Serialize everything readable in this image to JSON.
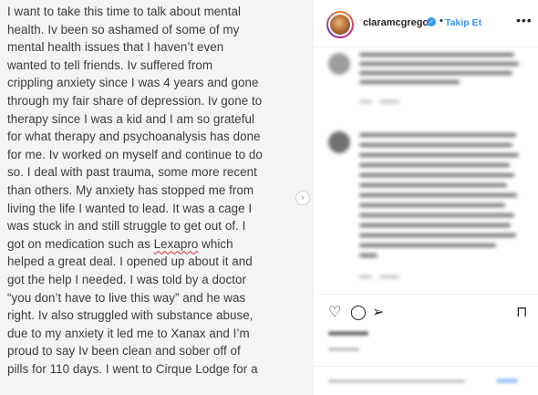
{
  "post": {
    "lines": [
      "I  want to take this time to talk about mental",
      "health. Iv been so ashamed of some of my",
      "mental health issues that I haven’t even",
      "wanted to tell friends. Iv suffered from",
      "crippling anxiety since I was 4 years and gone",
      "through my fair share of depression. Iv gone to",
      "therapy since I was a kid and I am so grateful",
      "for what therapy and psychoanalysis has done",
      "for me. Iv worked on myself and continue to do",
      "so. I deal with past trauma, some more recent",
      "than others. My anxiety has stopped me from",
      "living the life I wanted to lead. It was a cage I",
      "was stuck in and still struggle to get out of. I",
      "got on medication such as ",
      "helped a great deal. I opened up about it and",
      "got the help I needed. I was told by a doctor",
      "“you don’t have to live this way” and he was",
      "right. Iv also struggled with substance abuse,",
      "due to my anxiety it led me to Xanax and I’m",
      "proud to say Iv been clean and sober off of",
      "pills for 110 days. I went to Cirque Lodge for a"
    ],
    "misspelled_word": "Lexapro",
    "line14_tail": " which"
  },
  "header": {
    "username": "claramcgregor",
    "separator": "•",
    "follow_label": "Takip Et",
    "more_label": "•••"
  },
  "actions": {
    "heart_icon": "♡",
    "comment_icon": "◯",
    "share_icon": "➢",
    "save_icon": "⊓"
  },
  "nav": {
    "next_icon": "›"
  },
  "colors": {
    "accent": "#3897f0",
    "text": "#262626",
    "post_text": "#3b3b3b"
  }
}
